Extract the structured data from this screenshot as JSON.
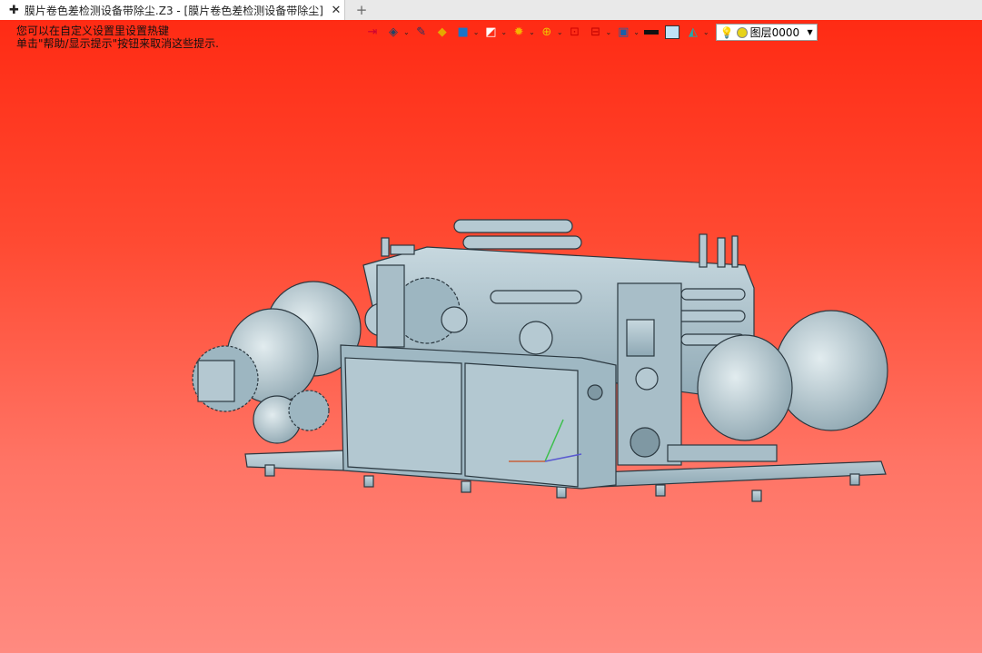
{
  "tab": {
    "add_icon": "plus-icon",
    "title": "膜片卷色差检测设备带除尘.Z3 - [膜片卷色差检测设备带除尘]",
    "close_glyph": "✕",
    "new_tab_glyph": "+"
  },
  "hint": {
    "line1": "您可以在自定义设置里设置热键",
    "line2": "单击\"帮助/显示提示\"按钮来取消这些提示."
  },
  "toolbar": {
    "icons": [
      "exit-view-icon",
      "view-style-icon",
      "pencil-icon",
      "shading-icon",
      "box-view-icon",
      "cube-view-icon",
      "wheel-icon",
      "zoom-icon",
      "fit-icon",
      "section-icon",
      "display-icon",
      "line-color-icon",
      "fill-color-icon",
      "layer-visibility-icon"
    ],
    "layer": {
      "value": "图层0000"
    }
  },
  "colors": {
    "background_top": "#ff2b14",
    "background_bottom": "#ff8a80",
    "model": "#a9c1cc"
  }
}
